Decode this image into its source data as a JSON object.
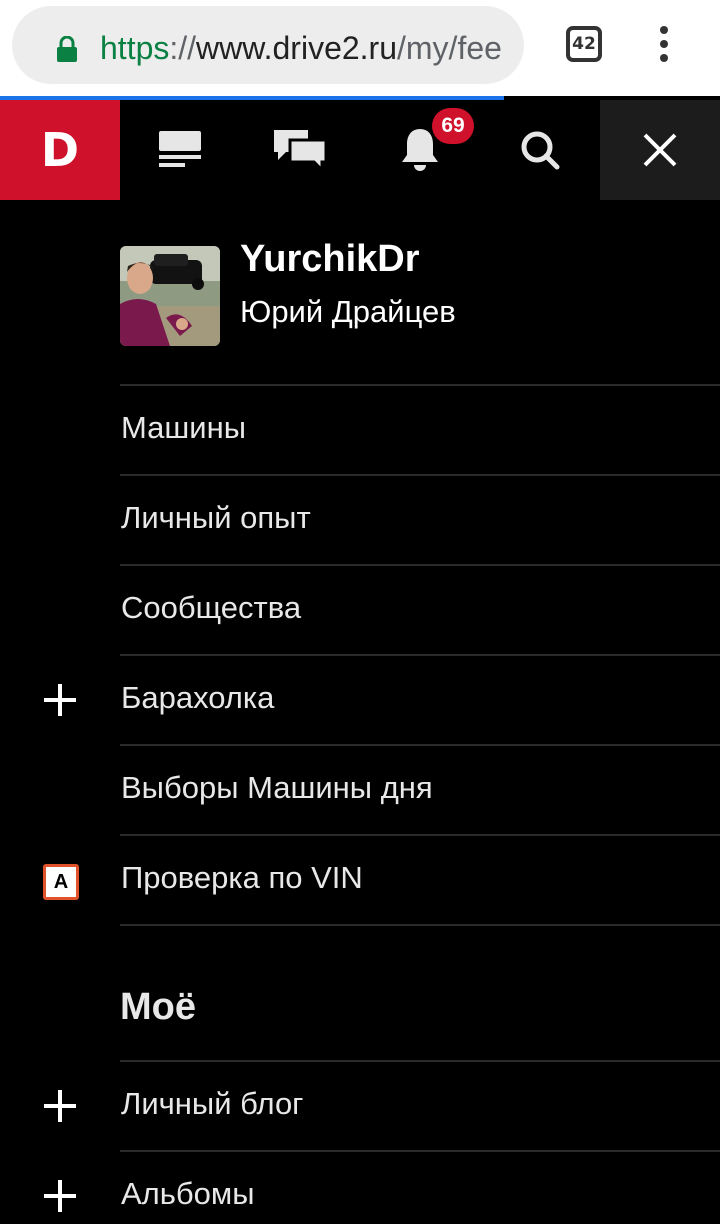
{
  "browser": {
    "url_scheme": "https",
    "url_sep": "://",
    "url_host": "www.drive2.ru",
    "url_path": "/my/fee",
    "tab_count": "42"
  },
  "nav": {
    "logo": "D",
    "icons": [
      "feed-icon",
      "messages-icon",
      "bell-icon",
      "search-icon",
      "close-icon"
    ],
    "notifications_count": "69",
    "brand_color": "#d0112b"
  },
  "profile": {
    "username": "YurchikDr",
    "full_name": "Юрий Драйцев"
  },
  "menu": {
    "items": [
      {
        "label": "Машины"
      },
      {
        "label": "Личный опыт"
      },
      {
        "label": "Сообщества"
      },
      {
        "label": "Барахолка",
        "icon": "plus-icon"
      },
      {
        "label": "Выборы Машины дня"
      },
      {
        "label": "Проверка по VIN",
        "icon": "vin-icon",
        "icon_text": "A"
      }
    ],
    "section_title": "Моё",
    "my_items": [
      {
        "label": "Личный блог",
        "icon": "plus-icon"
      },
      {
        "label": "Альбомы",
        "icon": "plus-icon"
      }
    ]
  }
}
